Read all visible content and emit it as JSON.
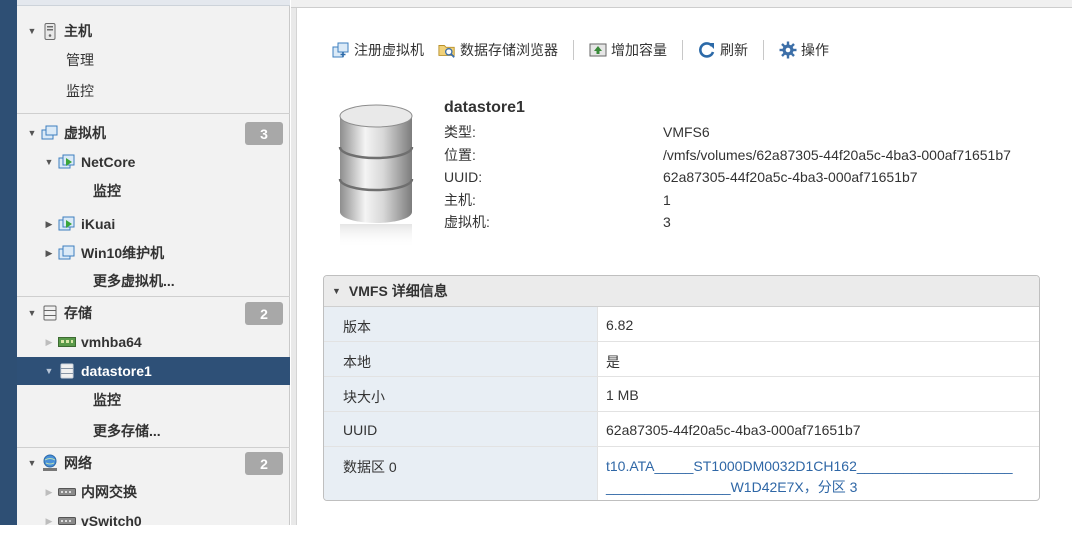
{
  "navigator": {
    "host": {
      "label": "主机",
      "children": [
        "管理",
        "监控"
      ]
    },
    "vms": {
      "label": "虚拟机",
      "count": "3",
      "items": [
        {
          "label": "NetCore",
          "sub": "监控"
        },
        {
          "label": "iKuai"
        },
        {
          "label": "Win10维护机"
        }
      ],
      "more": "更多虚拟机..."
    },
    "storage": {
      "label": "存储",
      "count": "2",
      "items": [
        {
          "label": "vmhba64"
        },
        {
          "label": "datastore1",
          "sub": "监控"
        }
      ],
      "more": "更多存储..."
    },
    "network": {
      "label": "网络",
      "count": "2",
      "items": [
        {
          "label": "内网交换"
        },
        {
          "label": "vSwitch0"
        }
      ]
    }
  },
  "toolbar": {
    "register_vm": "注册虚拟机",
    "datastore_browser": "数据存储浏览器",
    "increase_capacity": "增加容量",
    "refresh": "刷新",
    "actions": "操作"
  },
  "datastore": {
    "name": "datastore1",
    "props": [
      {
        "key": "类型:",
        "value": "VMFS6"
      },
      {
        "key": "位置:",
        "value": "/vmfs/volumes/62a87305-44f20a5c-4ba3-000af71651b7"
      },
      {
        "key": "UUID:",
        "value": "62a87305-44f20a5c-4ba3-000af71651b7"
      },
      {
        "key": "主机:",
        "value": "1"
      },
      {
        "key": "虚拟机:",
        "value": "3"
      }
    ]
  },
  "vmfs_panel": {
    "title": "VMFS 详细信息",
    "rows": [
      {
        "key": "版本",
        "value": "6.82"
      },
      {
        "key": "本地",
        "value": "是"
      },
      {
        "key": "块大小",
        "value": "1 MB"
      },
      {
        "key": "UUID",
        "value": "62a87305-44f20a5c-4ba3-000af71651b7"
      },
      {
        "key": "数据区 0",
        "value_line1": "t10.ATA_____ST1000DM0032D1CH162____________________",
        "value_line2": "________________W1D42E7X，分区 3"
      }
    ]
  },
  "colors": {
    "selected_bg": "#2e5077",
    "badge": "#a8a8a8",
    "link": "#2f67a6",
    "key_bg": "#e8eef4"
  }
}
